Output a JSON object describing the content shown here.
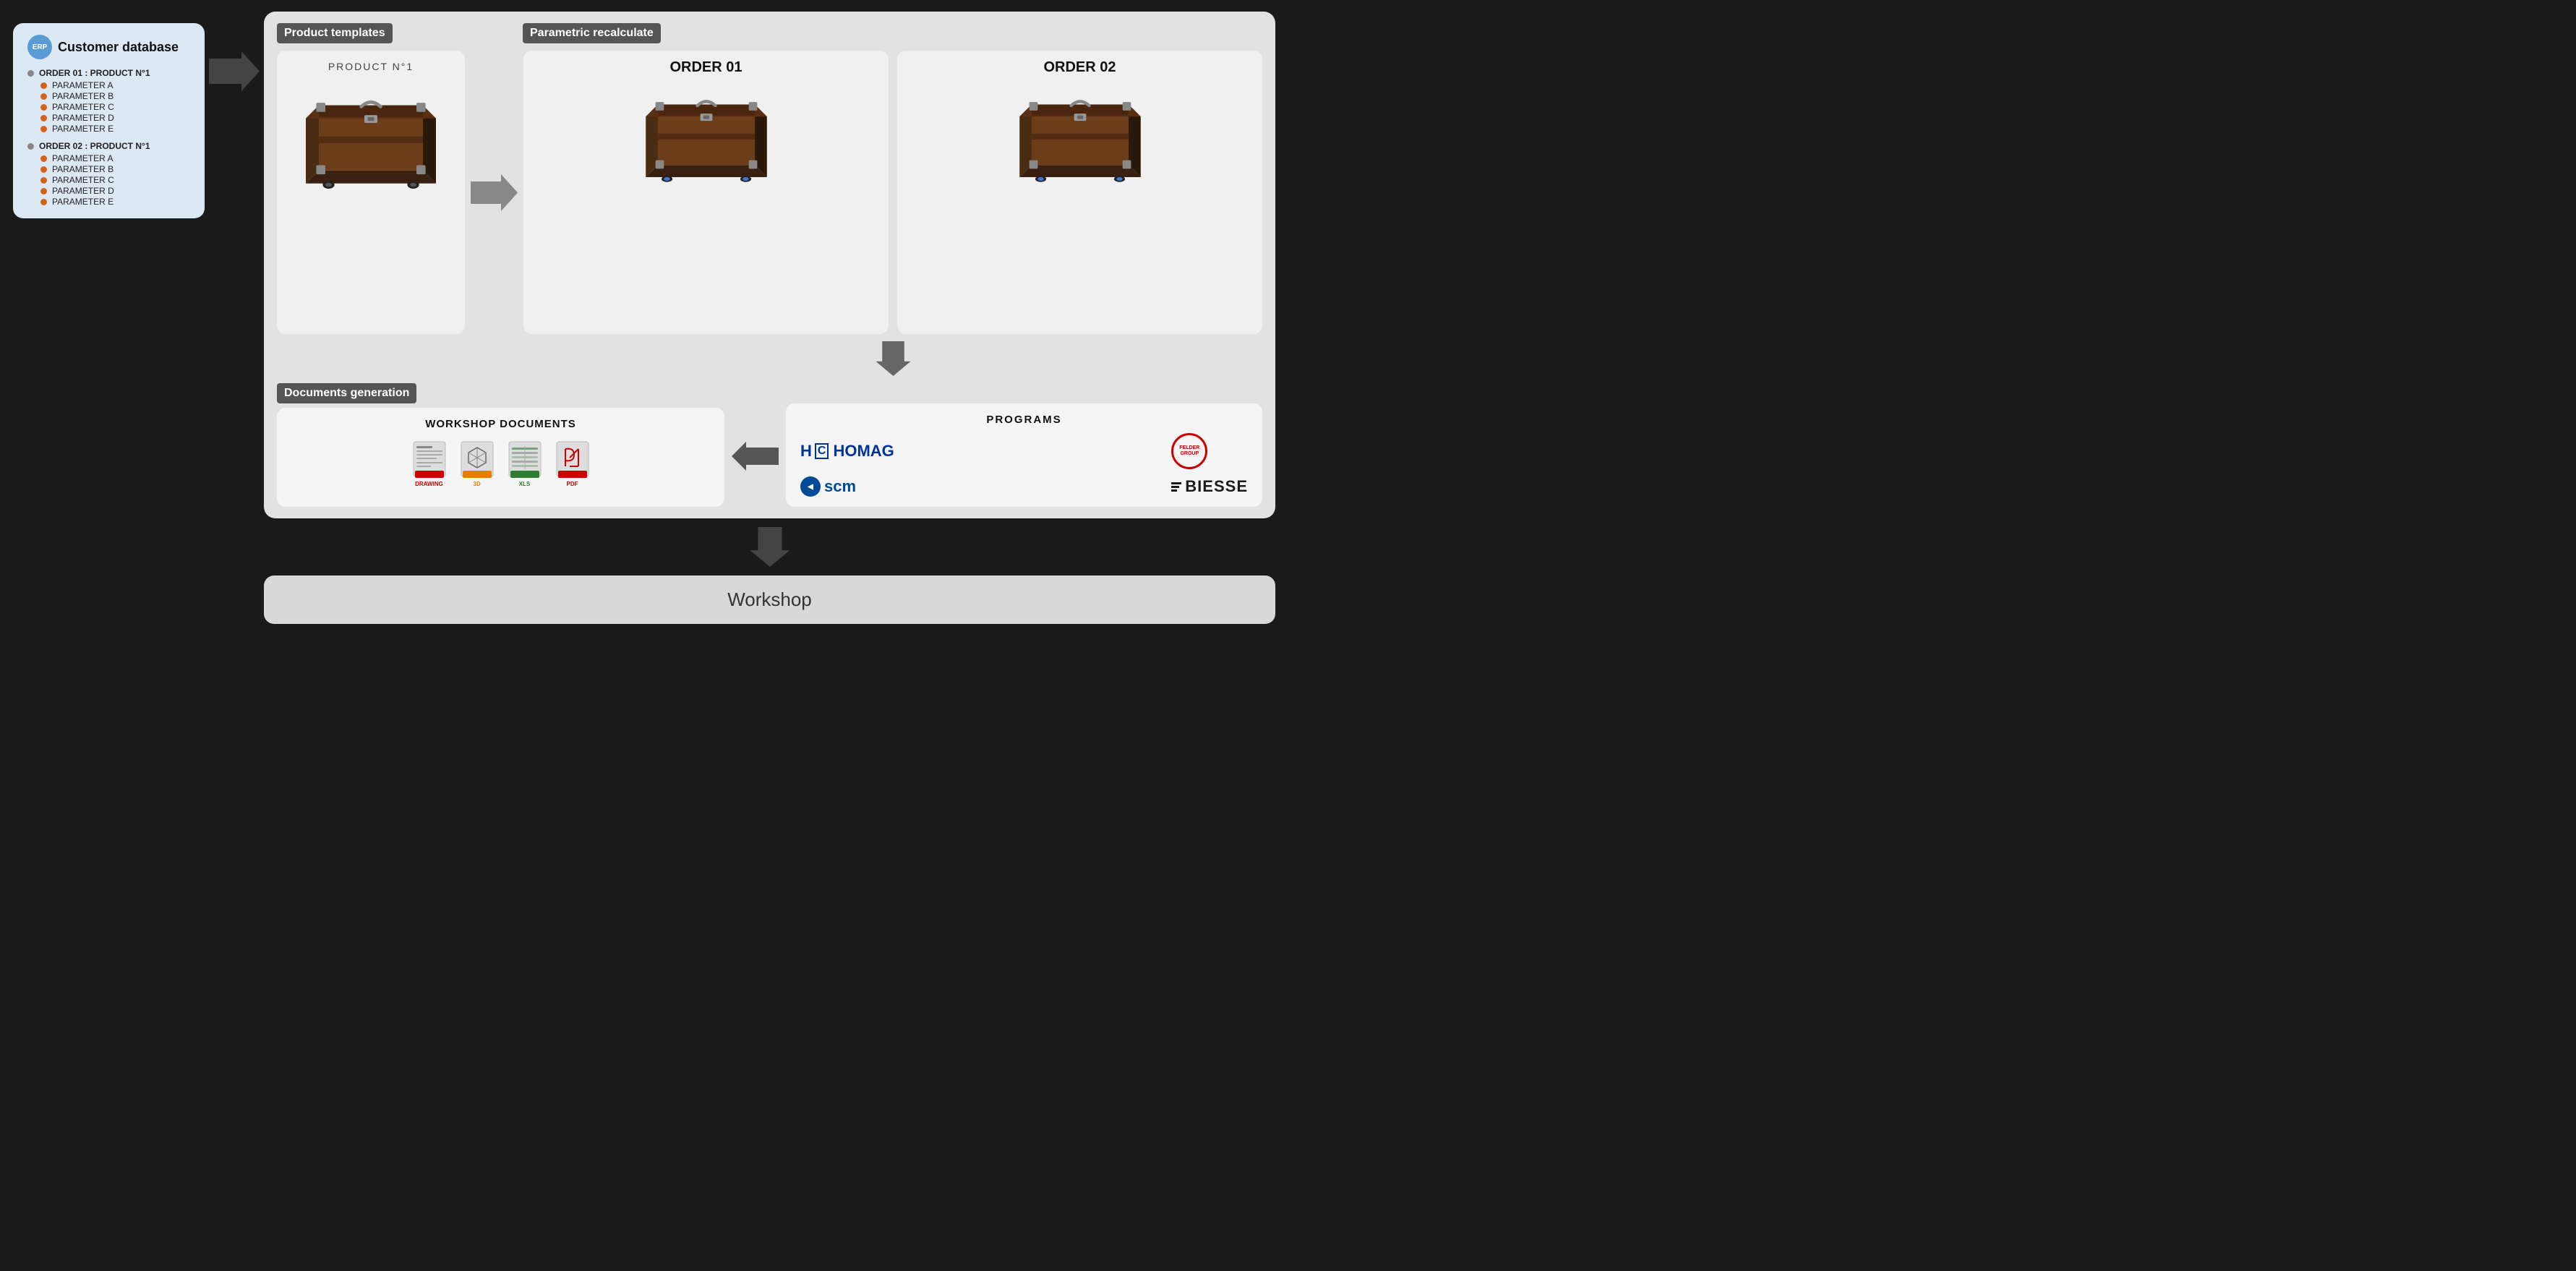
{
  "background_color": "#1a1a1a",
  "customer_db": {
    "title": "Customer database",
    "erp_label": "ERP",
    "orders": [
      {
        "label": "ORDER 01 : PRODUCT N°1",
        "params": [
          "PARAMETER A",
          "PARAMETER B",
          "PARAMETER C",
          "PARAMETER D",
          "PARAMETER E"
        ]
      },
      {
        "label": "ORDER 02 : PRODUCT N°1",
        "params": [
          "PARAMETER A",
          "PARAMETER B",
          "PARAMETER C",
          "PARAMETER D",
          "PARAMETER E"
        ]
      }
    ]
  },
  "product_templates": {
    "section_label": "Product templates",
    "product_label": "PRODUCT N°1"
  },
  "parametric_recalculate": {
    "section_label": "Parametric recalculate",
    "orders": [
      "ORDER 01",
      "ORDER 02"
    ]
  },
  "documents_generation": {
    "section_label": "Documents generation",
    "box_title": "WORKSHOP DOCUMENTS",
    "doc_types": [
      {
        "label": "DRAWING",
        "color": "#cc0000",
        "type": "drawing"
      },
      {
        "label": "3D",
        "color": "#e67e00",
        "type": "3d"
      },
      {
        "label": "XLS",
        "color": "#2e7d32",
        "type": "xls"
      },
      {
        "label": "PDF",
        "color": "#cc0000",
        "type": "pdf"
      }
    ]
  },
  "programs": {
    "title": "PROGRAMS",
    "logos": [
      "HOMAG",
      "FELDER GROUP",
      "scm",
      "BIESSE"
    ]
  },
  "workshop": {
    "label": "Workshop"
  }
}
